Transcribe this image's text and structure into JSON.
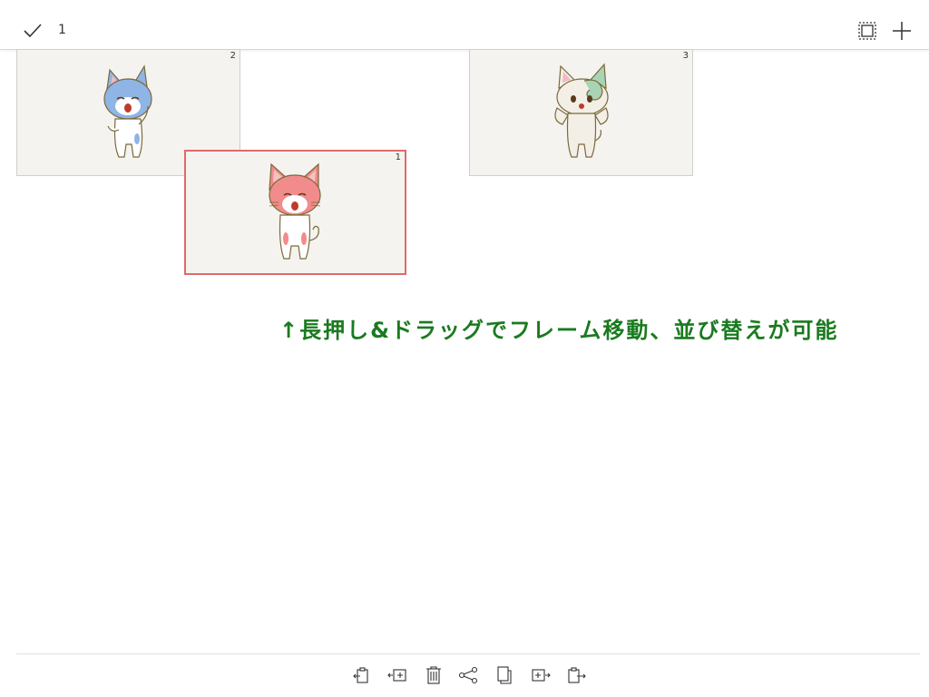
{
  "header": {
    "selected_count": "1",
    "icons": [
      "check-icon",
      "select-all-icon",
      "add-icon"
    ]
  },
  "frames": [
    {
      "number": "2",
      "character": "blue-cat",
      "color": "#8fb4e6",
      "selected": false
    },
    {
      "number": "1",
      "character": "pink-cat",
      "color": "#f28b8b",
      "selected": true
    },
    {
      "number": "3",
      "character": "mint-cat",
      "color": "#a8d4b5",
      "selected": false
    }
  ],
  "hint": {
    "text": "↑長押し&ドラッグでフレーム移動、並び替えが可能",
    "color": "#1a7a1f"
  },
  "toolbar": {
    "icons": [
      "paste-before-icon",
      "insert-frame-icon",
      "trash-icon",
      "share-icon",
      "copy-icon",
      "insert-after-icon",
      "paste-after-icon"
    ]
  },
  "colors": {
    "selection_border": "#e06a6a",
    "frame_bg": "#f5f3ef"
  }
}
